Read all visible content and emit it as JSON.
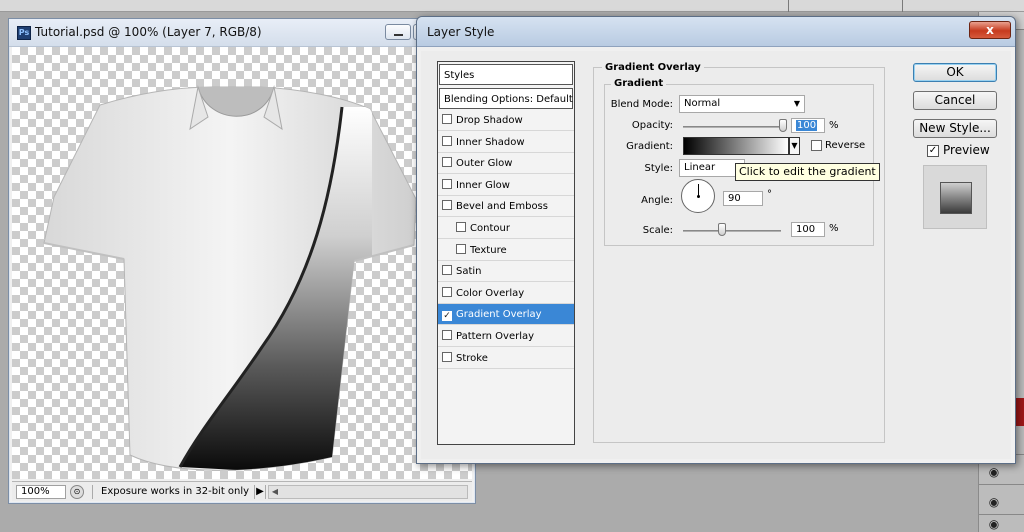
{
  "document": {
    "title": "Tutorial.psd @ 100% (Layer 7, RGB/8)",
    "app_icon": "Ps",
    "zoom": "100%",
    "status_text": "Exposure works in 32-bit only"
  },
  "dialog": {
    "title": "Layer Style",
    "close": "x",
    "styles_header": "Styles",
    "blending_options": "Blending Options: Default",
    "effects": [
      {
        "label": "Drop Shadow",
        "checked": false,
        "sub": false
      },
      {
        "label": "Inner Shadow",
        "checked": false,
        "sub": false
      },
      {
        "label": "Outer Glow",
        "checked": false,
        "sub": false
      },
      {
        "label": "Inner Glow",
        "checked": false,
        "sub": false
      },
      {
        "label": "Bevel and Emboss",
        "checked": false,
        "sub": false
      },
      {
        "label": "Contour",
        "checked": false,
        "sub": true
      },
      {
        "label": "Texture",
        "checked": false,
        "sub": true
      },
      {
        "label": "Satin",
        "checked": false,
        "sub": false
      },
      {
        "label": "Color Overlay",
        "checked": false,
        "sub": false
      },
      {
        "label": "Gradient Overlay",
        "checked": true,
        "sub": false,
        "selected": true
      },
      {
        "label": "Pattern Overlay",
        "checked": false,
        "sub": false
      },
      {
        "label": "Stroke",
        "checked": false,
        "sub": false
      }
    ],
    "panel": {
      "section_title": "Gradient Overlay",
      "group_title": "Gradient",
      "blend_mode_label": "Blend Mode:",
      "blend_mode_value": "Normal",
      "opacity_label": "Opacity:",
      "opacity_value": "100",
      "opacity_unit": "%",
      "opacity_fraction": 1.0,
      "gradient_label": "Gradient:",
      "reverse_label": "Reverse",
      "style_label": "Style:",
      "style_value": "Linear",
      "tooltip": "Click to edit the gradient",
      "angle_label": "Angle:",
      "angle_value": "90",
      "angle_unit": "°",
      "scale_label": "Scale:",
      "scale_value": "100",
      "scale_unit": "%",
      "scale_fraction": 0.4
    },
    "buttons": {
      "ok": "OK",
      "cancel": "Cancel",
      "new_style": "New Style...",
      "preview": "Preview"
    }
  },
  "colors": {
    "selection": "#3a87d6",
    "close_button": "#c63a1e",
    "tooltip_bg": "#ffffe1"
  }
}
